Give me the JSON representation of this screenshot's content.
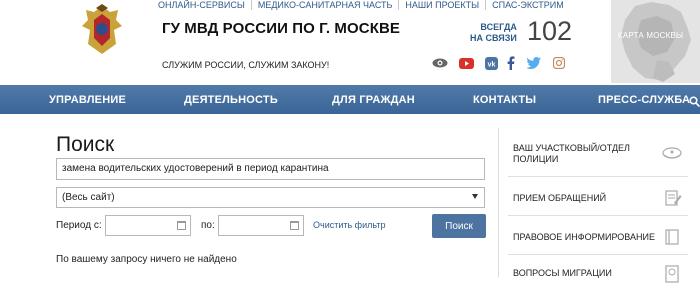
{
  "header": {
    "top_links": [
      "ОНЛАЙН-СЕРВИСЫ",
      "МЕДИКО-САНИТАРНАЯ ЧАСТЬ",
      "НАШИ ПРОЕКТЫ",
      "СПАС-ЭКСТРИМ"
    ],
    "title": "ГУ МВД РОССИИ ПО Г. МОСКВЕ",
    "slogan": "СЛУЖИМ РОССИИ, СЛУЖИМ ЗАКОНУ!",
    "hotline_line1": "ВСЕГДА",
    "hotline_line2": "НА СВЯЗИ",
    "hotline_number": "102",
    "map_label": "КАРТА МОСКВЫ",
    "social_icons": [
      "eye-icon",
      "youtube-icon",
      "vk-icon",
      "facebook-icon",
      "twitter-icon",
      "instagram-icon"
    ]
  },
  "nav": {
    "items": [
      "УПРАВЛЕНИЕ",
      "ДЕЯТЕЛЬНОСТЬ",
      "ДЛЯ ГРАЖДАН",
      "КОНТАКТЫ",
      "ПРЕСС-СЛУЖБА"
    ]
  },
  "search": {
    "heading": "Поиск",
    "query": "замена водительских удостоверений в период карантина",
    "scope": "(Весь сайт)",
    "period_from_label": "Период с:",
    "period_to_label": "по:",
    "clear_label": "Очистить фильтр",
    "button_label": "Поиск",
    "result_message": "По вашему запросу ничего не найдено"
  },
  "sidebar": {
    "items": [
      {
        "line1": "ВАШ УЧАСТКОВЫЙ/ОТДЕЛ",
        "line2": "ПОЛИЦИИ"
      },
      {
        "line1": "ПРИЕМ ОБРАЩЕНИЙ",
        "line2": ""
      },
      {
        "line1": "ПРАВОВОЕ ИНФОРМИРОВАНИЕ",
        "line2": ""
      },
      {
        "line1": "ВОПРОСЫ МИГРАЦИИ",
        "line2": ""
      }
    ]
  },
  "colors": {
    "nav_bg": "#3b6596",
    "link": "#2e5a8a",
    "button": "#4d73a0"
  }
}
